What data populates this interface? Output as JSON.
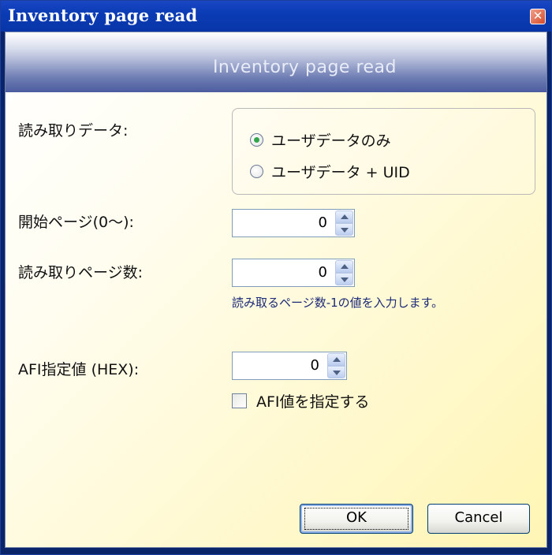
{
  "window": {
    "title": "Inventory page read",
    "close_glyph": "✕"
  },
  "header": {
    "title": "Inventory page read"
  },
  "form": {
    "read_data_label": "読み取りデータ:",
    "read_data_options": [
      {
        "label": "ユーザデータのみ",
        "selected": true
      },
      {
        "label": "ユーザデータ + UID",
        "selected": false
      }
    ],
    "start_page_label": "開始ページ(0〜):",
    "start_page_value": "0",
    "page_count_label": "読み取りページ数:",
    "page_count_value": "0",
    "page_count_hint": "読み取るページ数-1の値を入力します。",
    "afi_label": "AFI指定値 (HEX):",
    "afi_value": "0",
    "afi_checkbox_label": "AFI値を指定する",
    "afi_checkbox_checked": false
  },
  "buttons": {
    "ok": "OK",
    "cancel": "Cancel"
  },
  "colors": {
    "titlebar": "#0836a8",
    "accent_radio": "#33a64c",
    "hint_text": "#1d2a77",
    "client_bg": "#fff9d2"
  },
  "icons": [
    "close-icon",
    "spin-up-icon",
    "spin-down-icon"
  ]
}
